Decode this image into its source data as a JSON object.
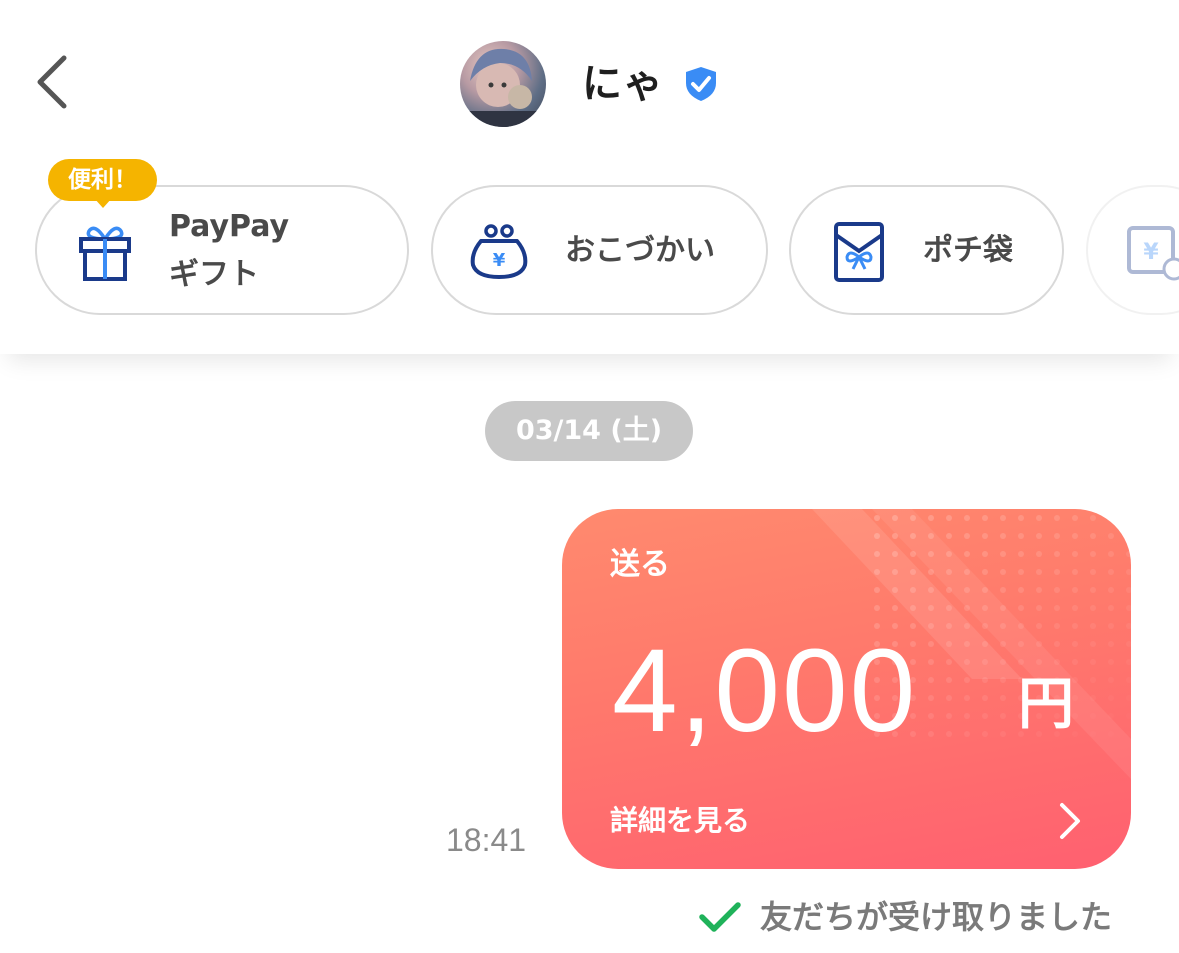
{
  "header": {
    "contact_name": "にゃ",
    "back_icon": "chevron-left-icon",
    "verified_icon": "shield-check-icon",
    "verified_color": "#3a8cf5"
  },
  "actions": {
    "badge": "便利！",
    "items": [
      {
        "label_line1": "PayPay",
        "label_line2": "ギフト",
        "icon": "gift-icon"
      },
      {
        "label": "おこづかい",
        "icon": "coin-purse-yen-icon"
      },
      {
        "label": "ポチ袋",
        "icon": "envelope-ribbon-icon"
      },
      {
        "label": "",
        "icon": "yen-card-icon"
      }
    ],
    "icon_color": "#1a3a8a",
    "accent_color": "#3a8cf5"
  },
  "chat": {
    "date": "03/14 (土)",
    "payment": {
      "type_label": "送る",
      "amount": "4,000",
      "currency": "円",
      "details_label": "詳細を見る"
    },
    "time": "18:41",
    "status": "友だちが受け取りました",
    "status_color": "#1fb25a"
  }
}
